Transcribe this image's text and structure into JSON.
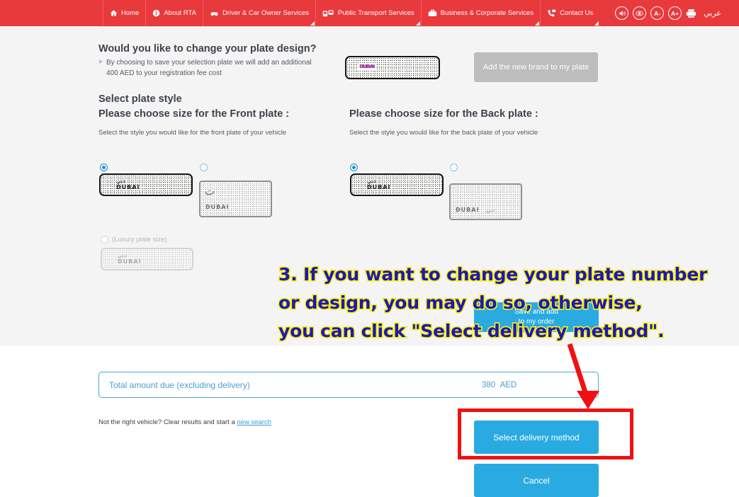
{
  "nav": {
    "items": [
      {
        "label": "Home",
        "icon": "home-icon",
        "caret": false
      },
      {
        "label": "About RTA",
        "icon": "info-icon",
        "caret": false
      },
      {
        "label": "Driver & Car Owner Services",
        "icon": "car-icon",
        "caret": true
      },
      {
        "label": "Public Transport Services",
        "icon": "bus-icon",
        "caret": true
      },
      {
        "label": "Business & Corporate Services",
        "icon": "briefcase-icon",
        "caret": true
      },
      {
        "label": "Contact Us",
        "icon": "phone-icon",
        "caret": true
      }
    ],
    "tools": [
      {
        "name": "sound-icon",
        "label": ""
      },
      {
        "name": "eye-icon",
        "label": ""
      },
      {
        "name": "decrease-font-icon",
        "label": "A-"
      },
      {
        "name": "increase-font-icon",
        "label": "A+"
      },
      {
        "name": "print-icon",
        "label": ""
      }
    ],
    "arabic_label": "عربي",
    "bar_color": "#e8393c"
  },
  "design_section": {
    "heading": "Would you like to change your plate design?",
    "bullet_text": "By choosing to save your selection plate we will add an additional 400 AED to your registration fee cost",
    "brand_button_label": "Add the new brand to my plate",
    "plate_preview_city": "DUBAI"
  },
  "style_section": {
    "heading": "Select plate style",
    "front": {
      "title": "Please choose size for the Front plate :",
      "note": "Select the style you would like for the front plate of your vehicle",
      "options": [
        {
          "name": "front-long-plate",
          "selected": true,
          "shape": "long"
        },
        {
          "name": "front-square-plate",
          "selected": false,
          "shape": "square"
        },
        {
          "name": "front-luxury-plate",
          "selected": false,
          "shape": "long",
          "label": "(Luxury plate size)",
          "disabled": true
        }
      ]
    },
    "back": {
      "title": "Please choose size for the Back plate :",
      "note": "Select the style you would like for the back plate of your vehicle",
      "options": [
        {
          "name": "back-long-plate",
          "selected": true,
          "shape": "long"
        },
        {
          "name": "back-square-plate",
          "selected": false,
          "shape": "square"
        }
      ]
    },
    "plate_city_label": "DUBAI"
  },
  "annotation": {
    "line1": "3. If you want to change your plate number",
    "line2": "or design, you may do so, otherwise,",
    "line3": "you can click \"Select delivery method\".",
    "text_color": "#1d18b5",
    "outline_color": "#f5f016",
    "arrow_color": "#ef1111",
    "highlight_box_color": "#ef1111"
  },
  "obscured_button": {
    "label_line1": "Save and add",
    "label_line2": "to my order"
  },
  "totals": {
    "label": "Total amount due (excluding delivery)",
    "amount": "380",
    "currency": "AED",
    "accent_color": "#4a9fd0"
  },
  "footer": {
    "note_prefix": "Not the right vehicle? Clear results and start a ",
    "link_label": "new search",
    "primary_button": "Select delivery method",
    "cancel_button": "Cancel",
    "button_color": "#29abe2"
  }
}
